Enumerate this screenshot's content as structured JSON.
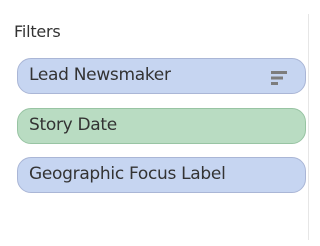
{
  "filters_shelf": {
    "title": "Filters",
    "pills": [
      {
        "label": "Lead Newsmaker",
        "type": "discrete-dimension",
        "color": "#c6d5f1",
        "icon": "sort-icon"
      },
      {
        "label": "Story Date",
        "type": "continuous-date",
        "color": "#b9dcc2"
      },
      {
        "label": "Geographic Focus Label",
        "type": "discrete-dimension",
        "color": "#c6d5f1"
      }
    ]
  }
}
